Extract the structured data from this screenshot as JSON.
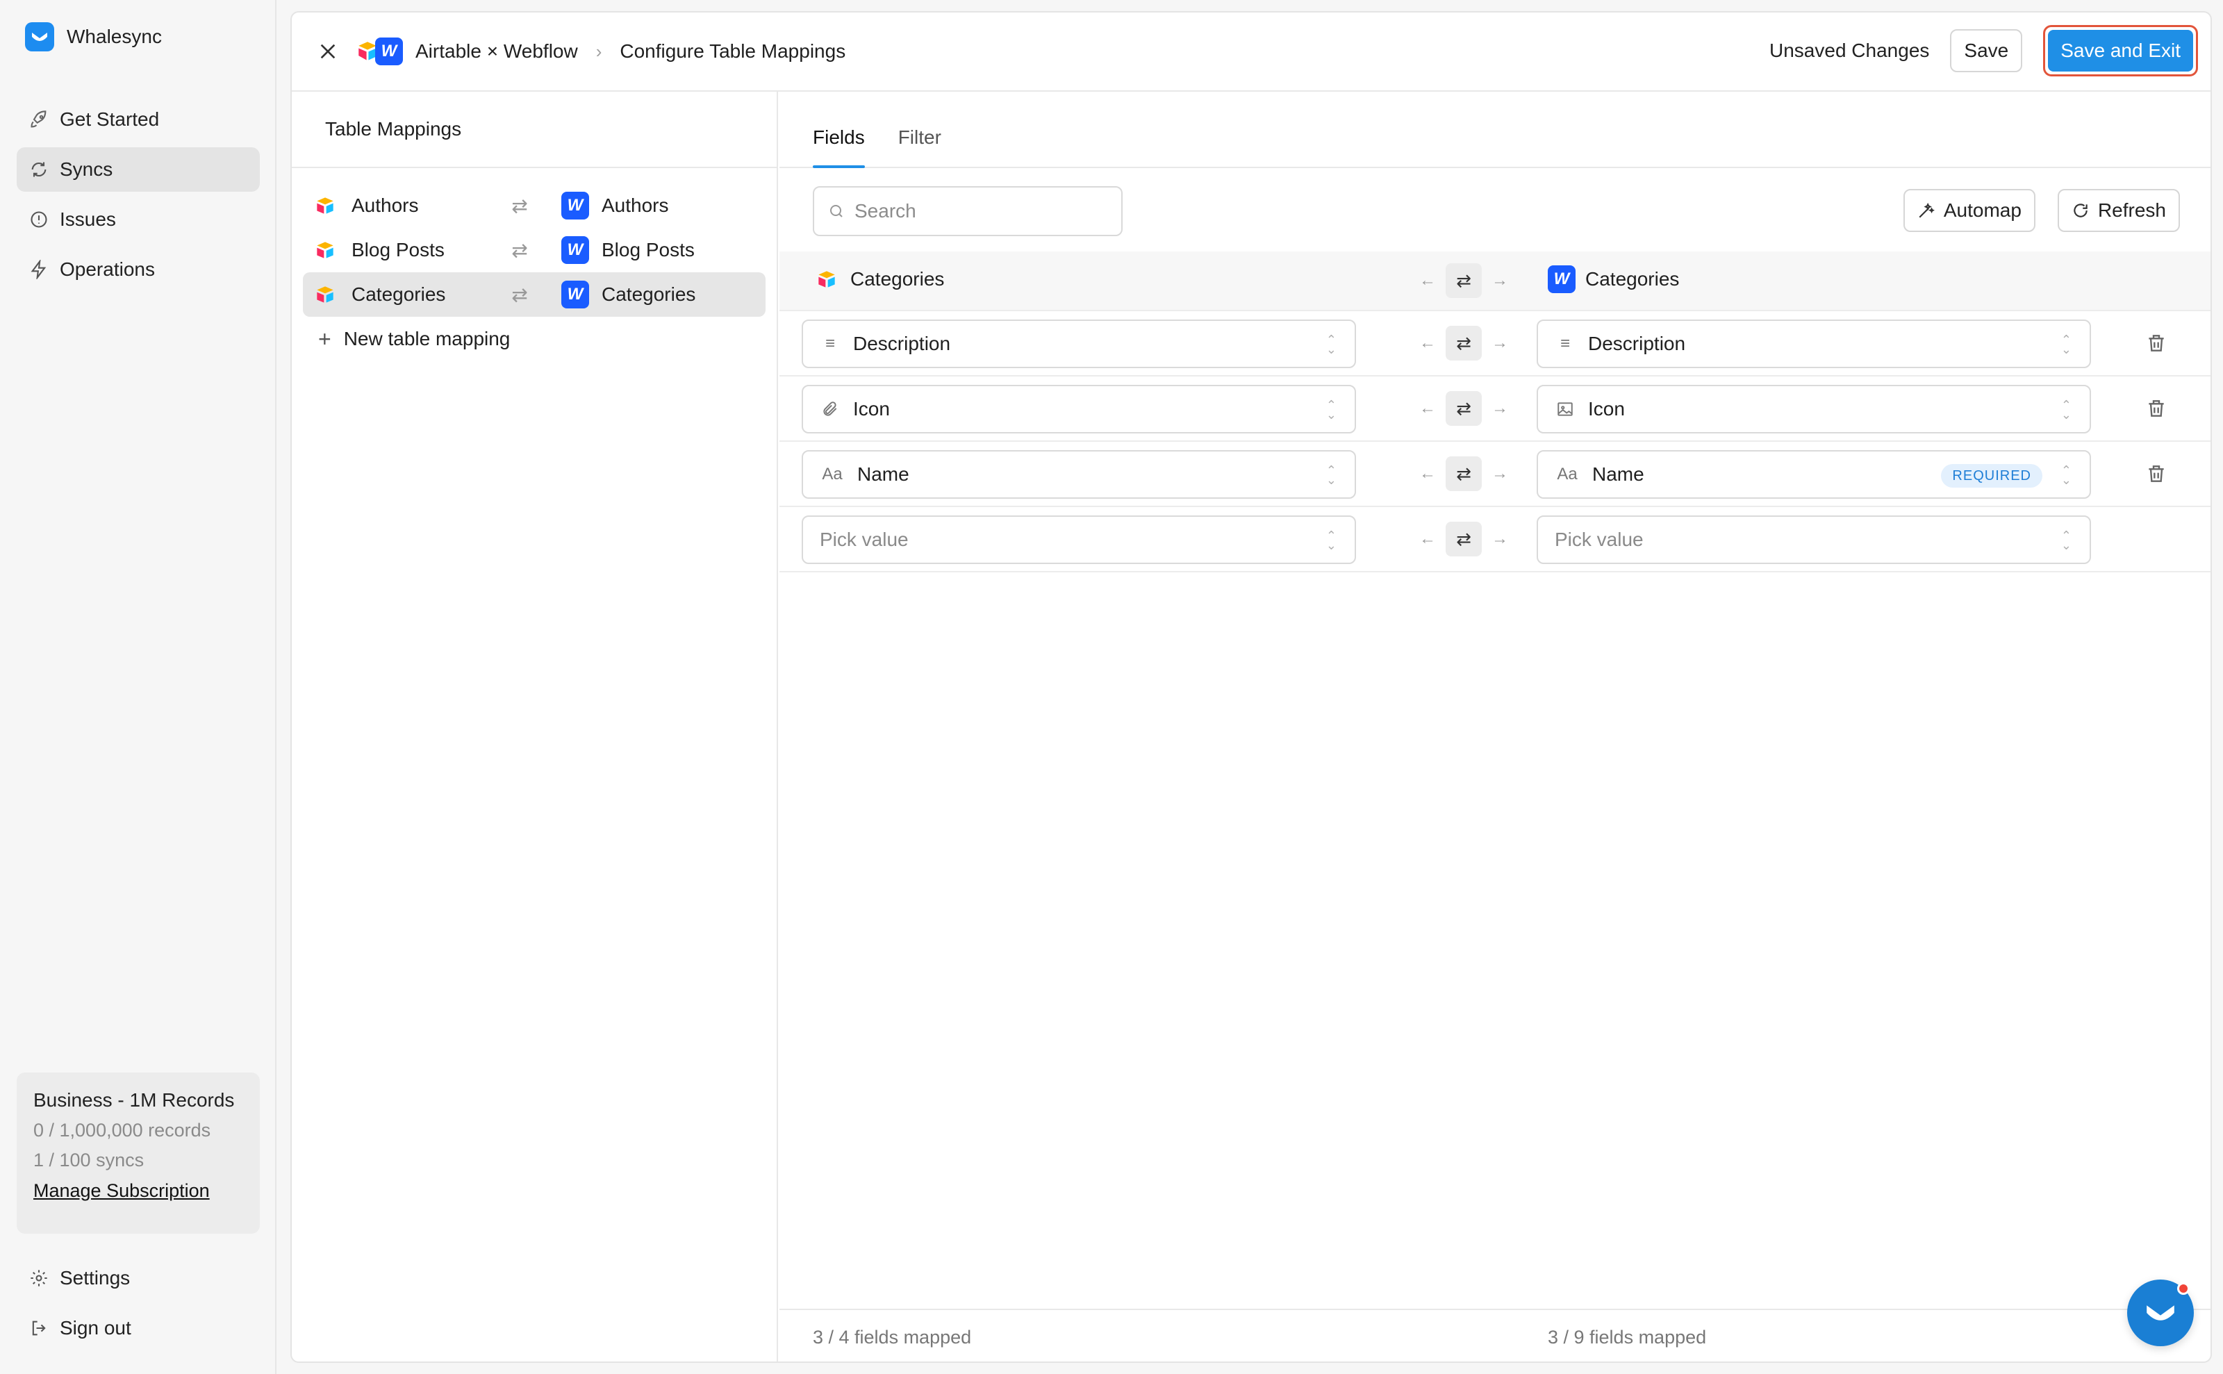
{
  "brand": {
    "name": "Whalesync"
  },
  "sidebar": {
    "items": [
      {
        "label": "Get Started",
        "icon": "rocket-icon"
      },
      {
        "label": "Syncs",
        "icon": "sync-icon"
      },
      {
        "label": "Issues",
        "icon": "alert-circle-icon"
      },
      {
        "label": "Operations",
        "icon": "bolt-icon"
      }
    ],
    "plan": {
      "title": "Business - 1M Records",
      "records": "0 / 1,000,000 records",
      "syncs": "1 / 100 syncs",
      "manage_link": "Manage Subscription"
    },
    "bottom_items": [
      {
        "label": "Settings",
        "icon": "gear-icon"
      },
      {
        "label": "Sign out",
        "icon": "sign-out-icon"
      }
    ]
  },
  "header": {
    "sync_name": "Airtable × Webflow",
    "page_title": "Configure Table Mappings",
    "status": "Unsaved Changes",
    "save_label": "Save",
    "save_exit_label": "Save and Exit"
  },
  "mappings": {
    "title": "Table Mappings",
    "rows": [
      {
        "source": "Authors",
        "target": "Authors"
      },
      {
        "source": "Blog Posts",
        "target": "Blog Posts"
      },
      {
        "source": "Categories",
        "target": "Categories"
      }
    ],
    "new_label": "New table mapping"
  },
  "fields": {
    "tabs": [
      "Fields",
      "Filter"
    ],
    "search_placeholder": "Search",
    "automap_label": "Automap",
    "refresh_label": "Refresh",
    "left_table": "Categories",
    "right_table": "Categories",
    "rows": [
      {
        "left": "Description",
        "right": "Description"
      },
      {
        "left": "Icon",
        "right": "Icon"
      },
      {
        "left": "Name",
        "right": "Name",
        "badge": "REQUIRED"
      },
      {
        "left_placeholder": "Pick value",
        "right_placeholder": "Pick value"
      }
    ],
    "footer_left": "3 / 4 fields mapped",
    "footer_right": "3 / 9 fields mapped"
  },
  "colors": {
    "accent": "#1f8fe6",
    "webflow": "#1a5cff",
    "highlight": "#e2553b"
  }
}
